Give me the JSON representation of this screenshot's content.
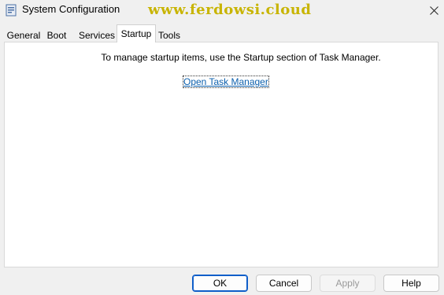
{
  "window": {
    "title": "System Configuration",
    "watermark": "www.ferdowsi.cloud",
    "close_icon": "close-icon"
  },
  "tabs": [
    {
      "label": "General",
      "active": false
    },
    {
      "label": "Boot",
      "active": false
    },
    {
      "label": "Services",
      "active": false
    },
    {
      "label": "Startup",
      "active": true
    },
    {
      "label": "Tools",
      "active": false
    }
  ],
  "startup": {
    "message": "To manage startup items, use the Startup section of Task Manager.",
    "link_label": "Open Task Manager"
  },
  "buttons": {
    "ok": "OK",
    "cancel": "Cancel",
    "apply": "Apply",
    "help": "Help"
  },
  "colors": {
    "link": "#0b5fad",
    "default_button_border": "#0f5ec9",
    "watermark": "#c8b400"
  }
}
